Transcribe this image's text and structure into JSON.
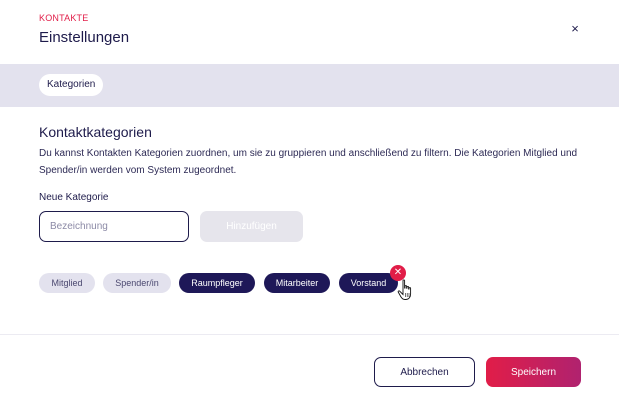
{
  "header": {
    "eyebrow": "KONTAKTE",
    "title": "Einstellungen",
    "close_label": "×"
  },
  "tabs": [
    {
      "label": "Kategorien",
      "active": true
    }
  ],
  "section": {
    "title": "Kontaktkategorien",
    "description": "Du kannst Kontakten Kategorien zuordnen, um sie zu gruppieren und anschließend zu filtern. Die Kategorien Mitglied und Spender/in werden vom System zugeordnet."
  },
  "new_category": {
    "label": "Neue Kategorie",
    "placeholder": "Bezeichnung",
    "value": "",
    "add_label": "Hinzufügen"
  },
  "categories": [
    {
      "label": "Mitglied",
      "system": true
    },
    {
      "label": "Spender/in",
      "system": true
    },
    {
      "label": "Raumpfleger",
      "system": false
    },
    {
      "label": "Mitarbeiter",
      "system": false
    },
    {
      "label": "Vorstand",
      "system": false
    }
  ],
  "remove_badge": {
    "icon": "close-icon",
    "label": "✕"
  },
  "footer": {
    "cancel_label": "Abbrechen",
    "save_label": "Speichern"
  },
  "colors": {
    "accent": "#e11d48",
    "primary": "#1e1b4b",
    "chip_dark": "#1e1858",
    "chip_light": "#e3e2ee",
    "tabbar": "#e3e2ee"
  }
}
